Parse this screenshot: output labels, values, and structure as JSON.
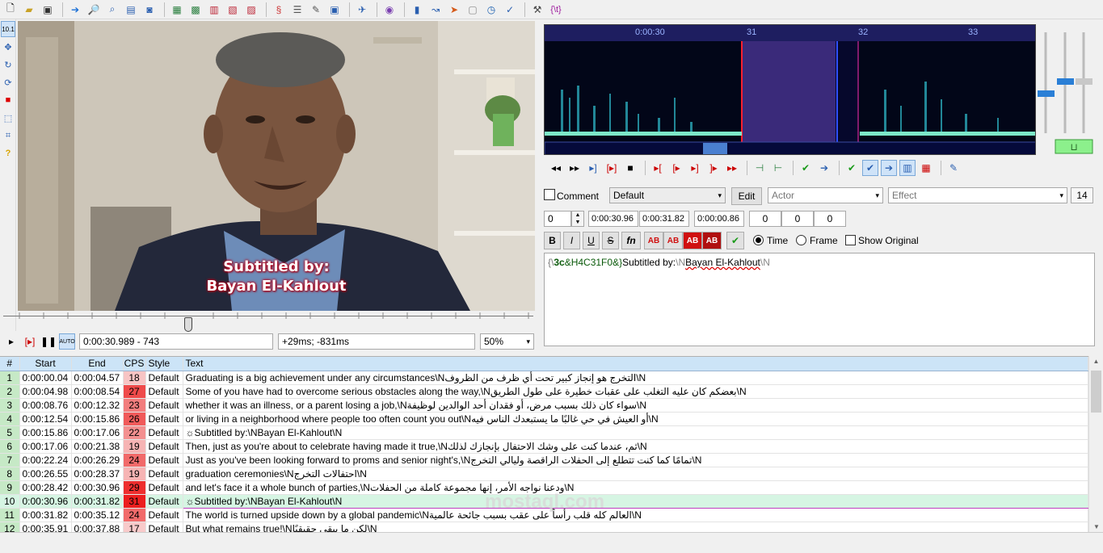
{
  "toolbar": {
    "icons": [
      "new-file-icon",
      "open-folder-icon",
      "save-icon",
      "play-icon",
      "zoom-in-icon",
      "zoom-out-icon",
      "jump-icon",
      "bomb-icon",
      "fullscreen-icon",
      "film-icon",
      "film-strip-icon",
      "film-alt-icon",
      "fonts-icon",
      "attach-icon",
      "styles-icon",
      "spell-check-icon",
      "kanji-icon",
      "translate-icon",
      "aegisub-icon",
      "video-icon",
      "export-icon",
      "resample-icon",
      "stop-icon",
      "clock-icon",
      "automation-icon",
      "macro-icon",
      "tools-icon",
      "regex-icon"
    ],
    "regex_label": "{\\t}"
  },
  "left_tools": {
    "zoom_label": "10.1"
  },
  "video": {
    "subtitle_line1": "Subtitled by:",
    "subtitle_line2": "Bayan El-Kahlout"
  },
  "video_controls": {
    "time": "0:00:30.989 - 743",
    "offset": "+29ms; -831ms",
    "zoom": "50%"
  },
  "audio": {
    "ruler": {
      "t1": "0:00:30",
      "t2": "31",
      "t3": "32",
      "t4": "33"
    }
  },
  "edit": {
    "comment_label": "Comment",
    "style": "Default",
    "edit_label": "Edit",
    "actor_placeholder": "Actor",
    "effect_placeholder": "Effect",
    "char_count": "14",
    "layer": "0",
    "start": "0:00:30.96",
    "end": "0:00:31.82",
    "duration": "0:00:00.86",
    "margin_l": "0",
    "margin_r": "0",
    "margin_v": "0",
    "bold": "B",
    "italic": "I",
    "underline": "U",
    "strike": "S",
    "fn": "fn",
    "color_ab": "AB",
    "time_label": "Time",
    "frame_label": "Frame",
    "show_original_label": "Show Original",
    "text_part1": "{\\",
    "text_part2": "3c",
    "text_part3": "&H4C31F0&}",
    "text_part4": "Subtitled by:",
    "text_part5": "\\N",
    "text_part6": "Bayan El-Kahlout",
    "text_part7": "\\N"
  },
  "grid": {
    "headers": [
      "#",
      "Start",
      "End",
      "CPS",
      "Style",
      "Text"
    ],
    "rows": [
      {
        "n": "1",
        "start": "0:00:00.04",
        "end": "0:00:04.57",
        "cps": "18",
        "style": "Default",
        "text": "Graduating is a big achievement under any circumstances\\Nالتخرج هو إنجاز كبير تحت أي ظرف من الظروف\\N"
      },
      {
        "n": "2",
        "start": "0:00:04.98",
        "end": "0:00:08.54",
        "cps": "27",
        "style": "Default",
        "text": " Some of you have had to overcome serious obstacles along the way,\\Nبعضكم كان عليه التغلب على عقبات خطيرة على طول الطريق\\N"
      },
      {
        "n": "3",
        "start": "0:00:08.76",
        "end": "0:00:12.32",
        "cps": "23",
        "style": "Default",
        "text": "whether it was an illness, or a parent losing a job,\\Nسواء كان ذلك بسبب مرض، أو فقدان أحد الوالدين لوظيفة\\N"
      },
      {
        "n": "4",
        "start": "0:00:12.54",
        "end": "0:00:15.86",
        "cps": "26",
        "style": "Default",
        "text": "or living in a neighborhood where people too often count you out\\Nأو العيش في حي غالبًا ما يستبعدك الناس فيه\\N"
      },
      {
        "n": "5",
        "start": "0:00:15.86",
        "end": "0:00:17.06",
        "cps": "22",
        "style": "Default",
        "text": "☼Subtitled by:\\NBayan El-Kahlout\\N"
      },
      {
        "n": "6",
        "start": "0:00:17.06",
        "end": "0:00:21.38",
        "cps": "19",
        "style": "Default",
        "text": "Then, just as you're about to celebrate having made it true,\\Nثم، عندما كنت على وشك الاحتفال بإنجازك لذلك\\N"
      },
      {
        "n": "7",
        "start": "0:00:22.24",
        "end": "0:00:26.29",
        "cps": "24",
        "style": "Default",
        "text": "Just as you've been looking forward to proms and senior night's,\\Nتمامًا كما كنت تتطلع إلى الحفلات الراقصة وليالي التخرج\\N"
      },
      {
        "n": "8",
        "start": "0:00:26.55",
        "end": "0:00:28.37",
        "cps": "19",
        "style": "Default",
        "text": "graduation ceremonies\\Nاحتفالات التخرج\\N"
      },
      {
        "n": "9",
        "start": "0:00:28.42",
        "end": "0:00:30.96",
        "cps": "29",
        "style": "Default",
        "text": "and let's face it a whole bunch of parties,\\Nودعنا نواجه الأمر، إنها مجموعة كاملة من الحفلات\\N"
      },
      {
        "n": "10",
        "start": "0:00:30.96",
        "end": "0:00:31.82",
        "cps": "31",
        "style": "Default",
        "text": "☼Subtitled by:\\NBayan El-Kahlout\\N"
      },
      {
        "n": "11",
        "start": "0:00:31.82",
        "end": "0:00:35.12",
        "cps": "24",
        "style": "Default",
        "text": "The world is turned upside down by a global pandemic\\Nالعالم كله قلب رأساً على عقب بسبب جائحة عالمية\\N"
      },
      {
        "n": "12",
        "start": "0:00:35.91",
        "end": "0:00:37.88",
        "cps": "17",
        "style": "Default",
        "text": "But what remains true!\\Nلكن ما يبقى حقيقيًا\\N"
      }
    ]
  },
  "watermark": "mostaql.com",
  "colors": {
    "accent": "#3b6fd8",
    "grid_header": "#cce4f7",
    "row_num": "#c6e9c6",
    "active_row": "#d6f5e3",
    "selection": "#3a2a7a"
  }
}
